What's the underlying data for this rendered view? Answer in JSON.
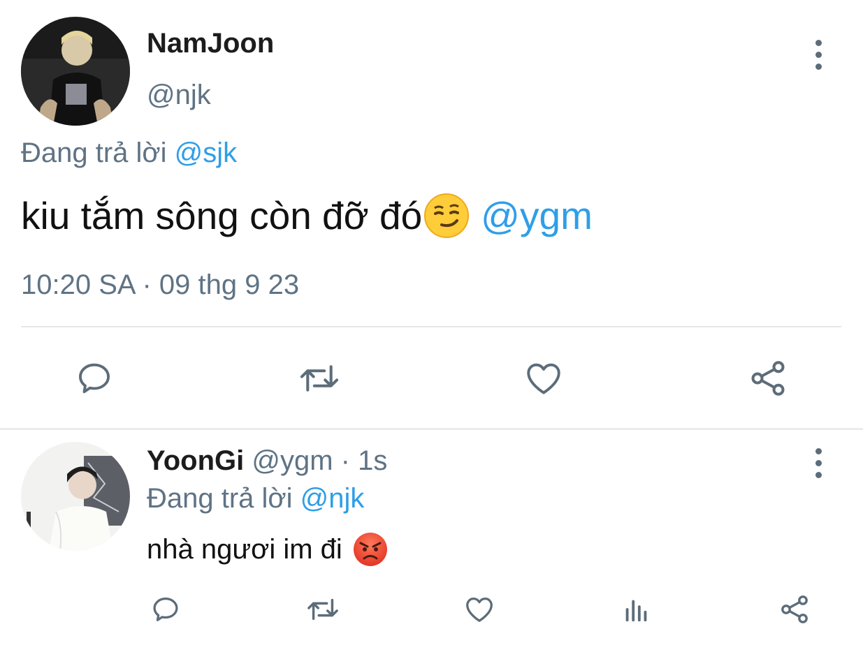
{
  "main_tweet": {
    "display_name": "NamJoon",
    "handle": "@njk",
    "reply_prefix": "Đang trả lời",
    "reply_to": "@sjk",
    "text": "kiu tắm sông còn đỡ đó",
    "mention": "@ygm",
    "timestamp": "10:20 SA · 09 thg 9 23",
    "avatar_icon": "user-photo-dark",
    "actions": [
      "reply-icon",
      "retweet-icon",
      "like-icon",
      "share-icon"
    ]
  },
  "reply_tweet": {
    "display_name": "YoonGi",
    "handle": "@ygm",
    "time_ago": "· 1s",
    "reply_prefix": "Đang trả lời",
    "reply_to": "@njk",
    "text": "nhà ngươi im đi",
    "avatar_icon": "user-photo-light",
    "actions": [
      "reply-icon",
      "retweet-icon",
      "like-icon",
      "analytics-icon",
      "share-icon"
    ]
  },
  "colors": {
    "link": "#2f9ee8",
    "muted": "#5f7384",
    "icon": "#5c6c79",
    "divider": "#e4e8eb"
  }
}
